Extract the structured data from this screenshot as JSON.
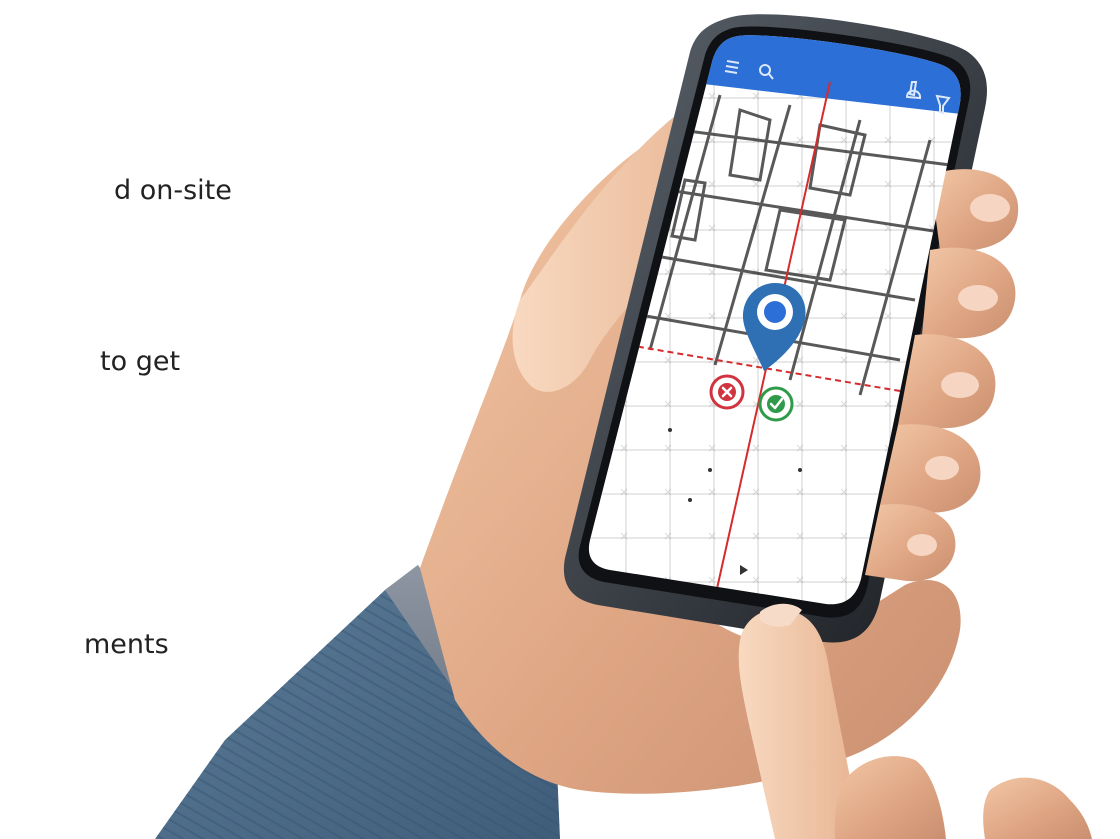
{
  "copy": {
    "line1": "d on-site",
    "line2": "to get",
    "line3": "ments"
  },
  "app": {
    "accent_color": "#2c6fd6",
    "pin_color": "#2f6fb3",
    "reject_color": "#d0343f",
    "accept_color": "#2f9a4a",
    "reference_line_color": "#d62b2b",
    "toolbar_icons": [
      "menu-icon",
      "search-icon",
      "hand-icon",
      "filter-icon"
    ]
  }
}
